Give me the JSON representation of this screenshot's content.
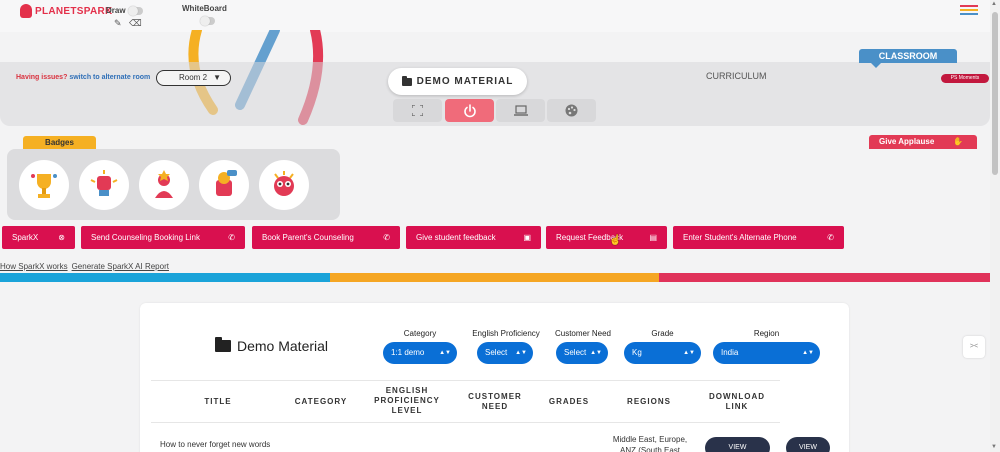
{
  "header": {
    "logo_text": "PLANETSPARK",
    "draw_label": "Draw",
    "whiteboard_label": "WhiteBoard",
    "menu_colors": [
      "#e23a55",
      "#f5b023",
      "#4a90c8",
      "#5cb85c"
    ]
  },
  "classroom": {
    "tab_label": "CLASSROOM",
    "issues_text": "Having issues?",
    "switch_link": "switch to alternate room",
    "room_value": "Room 2",
    "demo_material_label": "DEMO MATERIAL",
    "curriculum_label": "CURRICULUM",
    "ps_moments_label": "PS Moments"
  },
  "badges": {
    "tab_label": "Badges",
    "items": [
      "trophy-badge",
      "fist-badge",
      "star-badge",
      "lightbulb-badge",
      "owl-badge"
    ]
  },
  "applause": {
    "label": "Give Applause"
  },
  "actions": [
    {
      "label": "SparkX",
      "icon": "close-circle-icon"
    },
    {
      "label": "Send Counseling Booking Link",
      "icon": "phone-icon"
    },
    {
      "label": "Book Parent's Counseling",
      "icon": "phone-icon"
    },
    {
      "label": "Give student feedback",
      "icon": "feedback-icon"
    },
    {
      "label": "Request Feedback",
      "icon": "document-icon"
    },
    {
      "label": "Enter Student's Alternate Phone",
      "icon": "phone-icon"
    }
  ],
  "links": {
    "how_sparkx": "How SparkX works",
    "generate_report": "Generate SparkX AI Report"
  },
  "stripe_colors": [
    "#1aa3d9",
    "#f5a623",
    "#e0325a"
  ],
  "demo_material": {
    "title": "Demo Material",
    "filters": [
      {
        "label": "Category",
        "value": "1:1 demo"
      },
      {
        "label": "English Proficiency",
        "value": "Select"
      },
      {
        "label": "Customer Need",
        "value": "Select"
      },
      {
        "label": "Grade",
        "value": "Kg"
      },
      {
        "label": "Region",
        "value": "India"
      }
    ],
    "columns": [
      "TITLE",
      "CATEGORY",
      "ENGLISH PROFICIENCY LEVEL",
      "CUSTOMER NEED",
      "GRADES",
      "REGIONS",
      "DOWNLOAD LINK"
    ],
    "rows": [
      {
        "title": "How to never forget new words",
        "regions": "Middle East, Europe, ANZ (South East",
        "view_label": "VIEW",
        "view_label_2": "VIEW"
      }
    ]
  }
}
